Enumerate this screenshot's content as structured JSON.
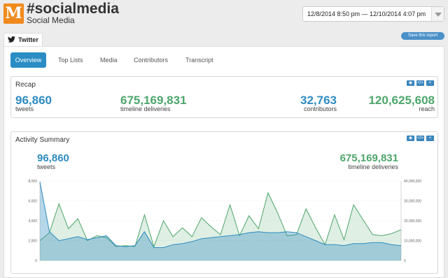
{
  "header": {
    "logo_letter": "M",
    "title": "#socialmedia",
    "subtitle": "Social Media",
    "date_range": "12/8/2014 8:50 pm — 12/10/2014 4:07 pm"
  },
  "source_tab": {
    "label": "Twitter",
    "icon": "twitter-bird-icon"
  },
  "save_button": "Save this report",
  "nav": {
    "tabs": [
      {
        "label": "Overview",
        "active": true
      },
      {
        "label": "Top Lists",
        "active": false
      },
      {
        "label": "Media",
        "active": false
      },
      {
        "label": "Contributors",
        "active": false
      },
      {
        "label": "Transcript",
        "active": false
      }
    ]
  },
  "recap": {
    "title": "Recap",
    "tweets": {
      "value": "96,860",
      "label": "tweets"
    },
    "timeline": {
      "value": "675,169,831",
      "label": "timeline deliveries"
    },
    "contributors": {
      "value": "32,763",
      "label": "contributors"
    },
    "reach": {
      "value": "120,625,608",
      "label": "reach"
    }
  },
  "activity": {
    "title": "Activity Summary",
    "tweets": {
      "value": "96,860",
      "label": "tweets"
    },
    "timeline": {
      "value": "675,169,831",
      "label": "timeline deliveries"
    }
  },
  "panel_icons": [
    "eye-icon",
    "code-icon",
    "share-icon"
  ],
  "colors": {
    "blue": "#2e8bc0",
    "green": "#4ea66b",
    "accent": "#2a8dc4",
    "logo": "#f08a1c"
  },
  "chart_data": {
    "type": "area",
    "y_left_ticks": [
      "8,000",
      "6,000",
      "4,000",
      "2,000",
      "0"
    ],
    "y_right_ticks": [
      "40,000,000",
      "30,000,000",
      "20,000,000",
      "10,000,000",
      "0"
    ],
    "ylim_left": [
      0,
      8000
    ],
    "ylim_right": [
      0,
      40000000
    ],
    "series": [
      {
        "name": "tweets",
        "axis": "left",
        "color": "#2e8bc0",
        "values": [
          7900,
          2900,
          2000,
          2200,
          2400,
          2100,
          2300,
          2500,
          1500,
          1400,
          1500,
          2900,
          1300,
          1300,
          1600,
          1700,
          1900,
          2200,
          2300,
          2400,
          2500,
          2600,
          2800,
          2900,
          2800,
          2800,
          2900,
          2800,
          2400,
          2000,
          1600,
          1600,
          1500,
          1700,
          1700,
          1800,
          1800,
          1600,
          1500
        ]
      },
      {
        "name": "timeline deliveries",
        "axis": "left-scaled",
        "color": "#4ea66b",
        "values": [
          2000,
          2800,
          5700,
          3200,
          4200,
          2000,
          2500,
          2300,
          1400,
          1500,
          1400,
          4600,
          1400,
          4000,
          2400,
          3300,
          2400,
          4300,
          3400,
          2600,
          5600,
          2500,
          4500,
          3200,
          6800,
          4800,
          2500,
          2600,
          5200,
          3300,
          1600,
          4600,
          2100,
          5600,
          4100,
          2600,
          2500,
          2700,
          3100
        ]
      }
    ]
  }
}
